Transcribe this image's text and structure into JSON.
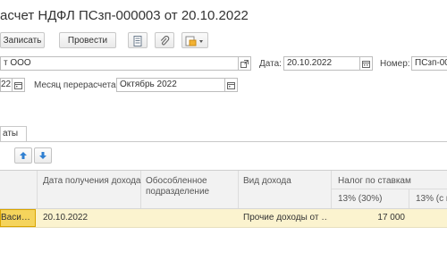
{
  "window": {
    "title": "асчет НДФЛ ПСзп-000003 от 20.10.2022"
  },
  "toolbar": {
    "save_label": "Записать",
    "post_label": "Провести"
  },
  "form": {
    "org_value": "т ООО",
    "date_label": "Дата:",
    "date_value": "20.10.2022",
    "number_label": "Номер:",
    "number_value": "ПСзп-00",
    "month_value": "22",
    "recalc_month_label": "Месяц перерасчета:",
    "recalc_month_value": "Октябрь 2022"
  },
  "tabs": [
    {
      "label": "аты"
    }
  ],
  "table": {
    "headers": {
      "date": "Дата получения дохода",
      "subdivision": "Обособленное подразделение",
      "income_type": "Вид дохода",
      "tax_by_rates": "Налог по ставкам",
      "rate_13_30": "13% (30%)",
      "rate_13_next": "13% (с п"
    },
    "rows": [
      {
        "employee": "Васи…",
        "date": "20.10.2022",
        "subdivision": "",
        "income_type": "Прочие доходы от …",
        "tax_13": "17 000",
        "tax_13_next": ""
      }
    ]
  }
}
